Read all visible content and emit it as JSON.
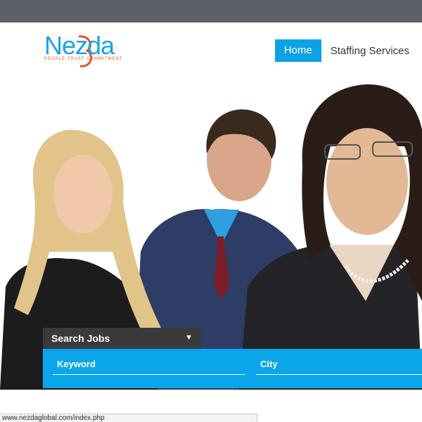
{
  "logo": {
    "name": "Nezda",
    "tagline": "PEOPLE   TRUST   COMMITMENT"
  },
  "nav": {
    "items": [
      {
        "label": "Home",
        "active": true
      },
      {
        "label": "Staffing Services",
        "active": false
      }
    ]
  },
  "search": {
    "title": "Search Jobs",
    "keyword_placeholder": "Keyword",
    "city_placeholder": "City"
  },
  "status_bar": {
    "url": "www.nezdaglobal.com/index.php"
  },
  "colors": {
    "topbar": "#5d6066",
    "accent": "#0da2e7",
    "search_head": "#3a3a3a",
    "logo_orange": "#e0542a"
  }
}
